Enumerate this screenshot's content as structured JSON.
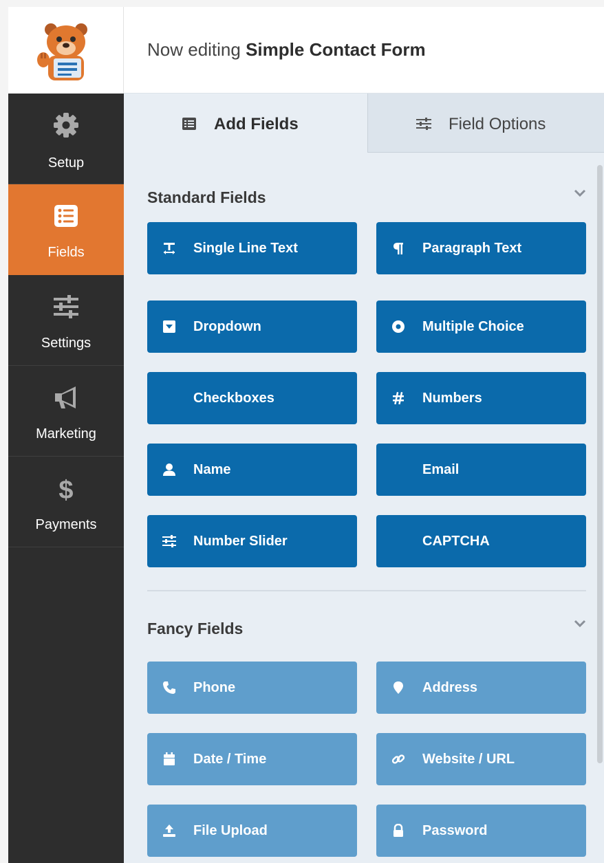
{
  "header": {
    "prefix": "Now editing",
    "form_name": "Simple Contact Form"
  },
  "sidebar": {
    "items": [
      {
        "label": "Setup",
        "icon": "gear-icon"
      },
      {
        "label": "Fields",
        "icon": "list-icon",
        "active": true
      },
      {
        "label": "Settings",
        "icon": "sliders-icon"
      },
      {
        "label": "Marketing",
        "icon": "megaphone-icon"
      },
      {
        "label": "Payments",
        "icon": "dollar-icon"
      }
    ]
  },
  "tabs": {
    "add_fields": "Add Fields",
    "field_options": "Field Options"
  },
  "standard": {
    "title": "Standard Fields",
    "fields": [
      {
        "label": "Single Line Text",
        "icon": "text-cursor-icon"
      },
      {
        "label": "Paragraph Text",
        "icon": "paragraph-icon"
      },
      {
        "label": "Dropdown",
        "icon": "caret-square-icon"
      },
      {
        "label": "Multiple Choice",
        "icon": "radio-dot-icon"
      },
      {
        "label": "Checkboxes",
        "icon": ""
      },
      {
        "label": "Numbers",
        "icon": "hash-icon"
      },
      {
        "label": "Name",
        "icon": "user-icon"
      },
      {
        "label": "Email",
        "icon": ""
      },
      {
        "label": "Number Slider",
        "icon": "sliders-icon"
      },
      {
        "label": "CAPTCHA",
        "icon": ""
      }
    ]
  },
  "fancy": {
    "title": "Fancy Fields",
    "fields": [
      {
        "label": "Phone",
        "icon": "phone-icon"
      },
      {
        "label": "Address",
        "icon": "map-pin-icon"
      },
      {
        "label": "Date / Time",
        "icon": "calendar-icon"
      },
      {
        "label": "Website / URL",
        "icon": "link-icon"
      },
      {
        "label": "File Upload",
        "icon": "upload-icon"
      },
      {
        "label": "Password",
        "icon": "lock-icon"
      }
    ]
  },
  "colors": {
    "sidebar_bg": "#2d2d2d",
    "active_nav": "#e27730",
    "standard_button": "#0b6aab",
    "fancy_button": "#5f9ecc",
    "content_bg": "#e8eef4"
  }
}
